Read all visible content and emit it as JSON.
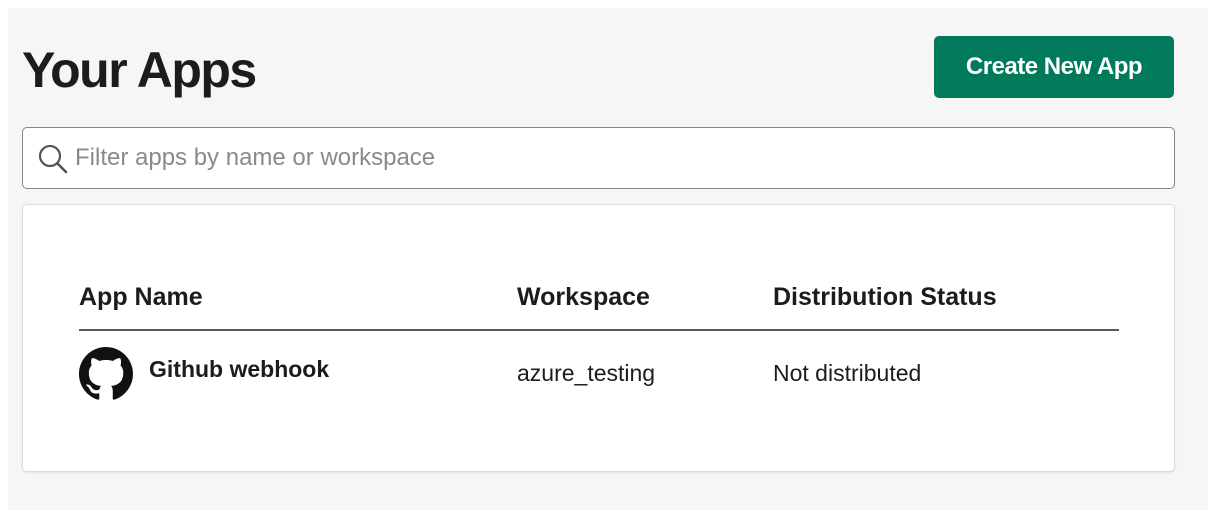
{
  "header": {
    "title": "Your Apps",
    "create_button_label": "Create New App"
  },
  "search": {
    "placeholder": "Filter apps by name or workspace",
    "value": ""
  },
  "table": {
    "columns": [
      "App Name",
      "Workspace",
      "Distribution Status"
    ],
    "rows": [
      {
        "app_name": "Github webhook",
        "icon": "github-icon",
        "workspace": "azure_testing",
        "distribution_status": "Not distributed"
      }
    ]
  },
  "colors": {
    "primary_button": "#007a5a",
    "page_background": "#f6f6f6",
    "text": "#1d1c1d"
  }
}
